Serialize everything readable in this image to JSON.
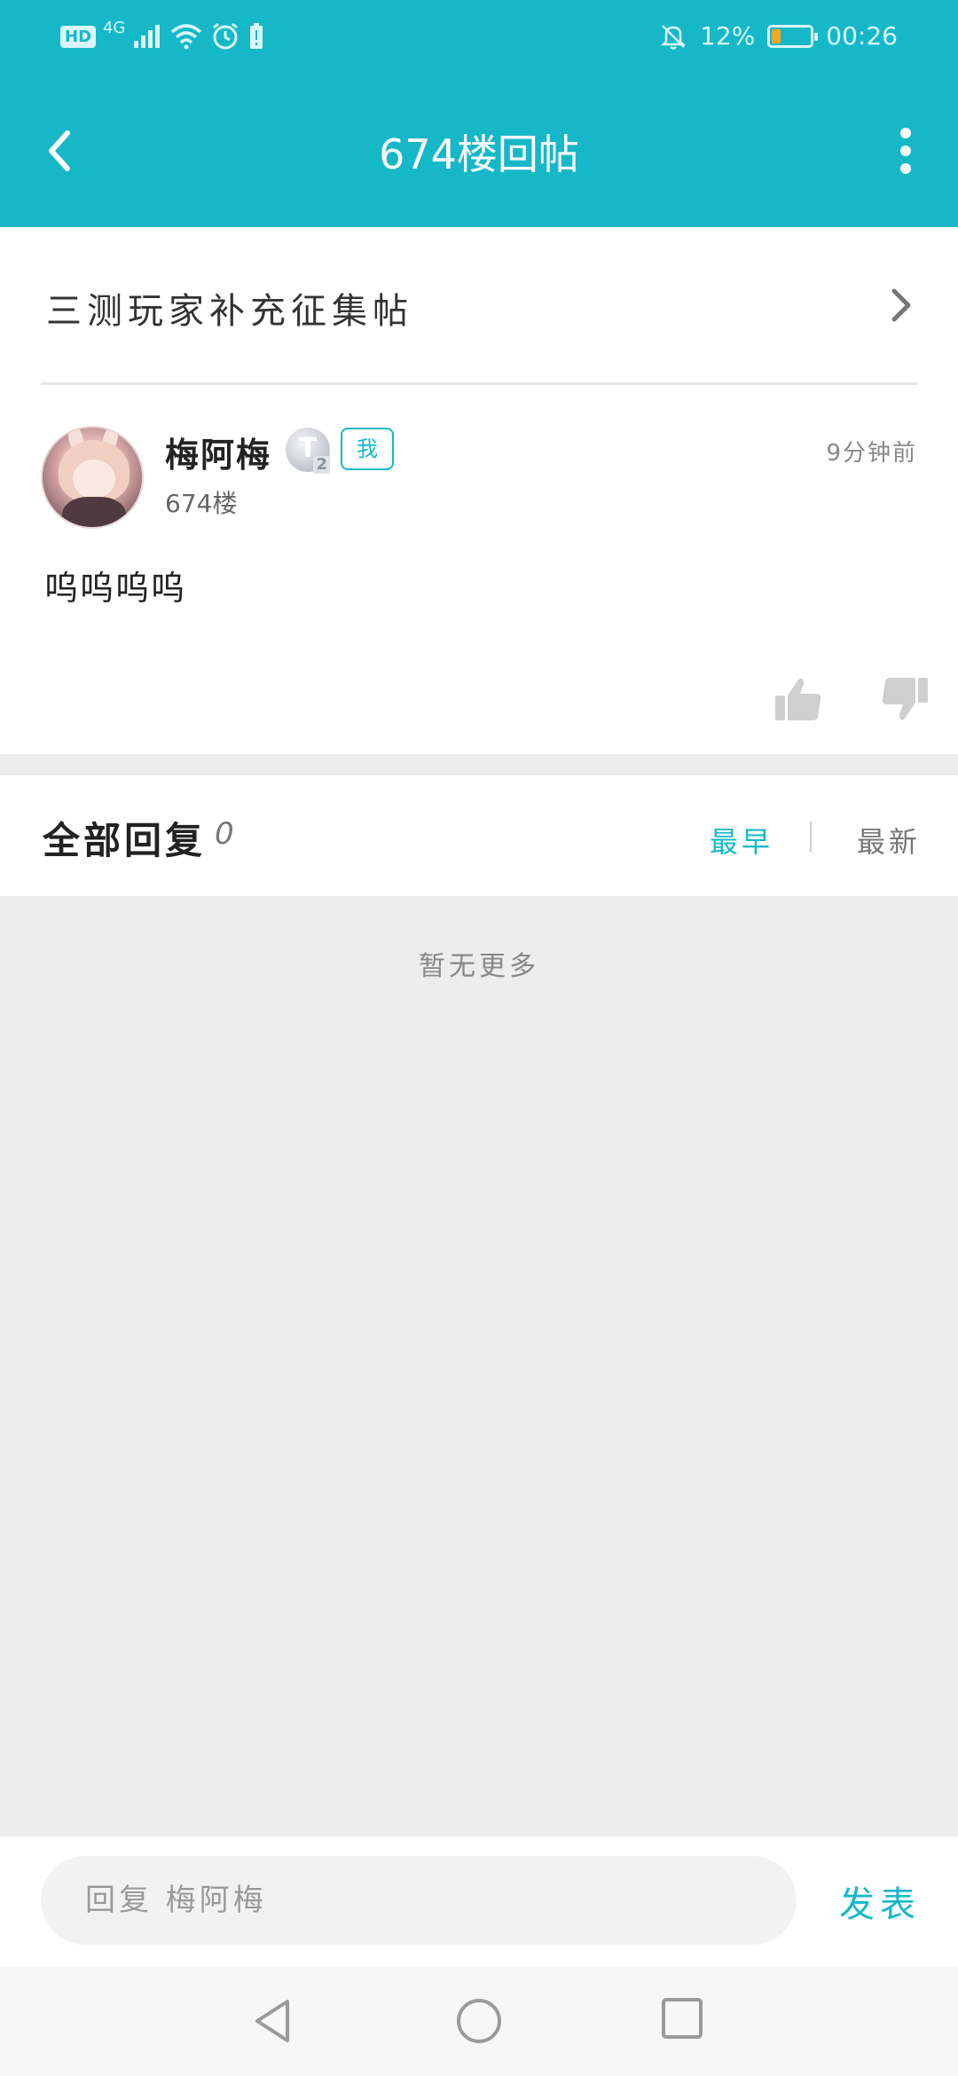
{
  "status_bar": {
    "network_badge": "HD",
    "network_type": "4G",
    "battery_percent": "12%",
    "time": "00:26",
    "battery_color": "#f5a623"
  },
  "header": {
    "title": "674楼回帖",
    "back_icon": "back-arrow-icon",
    "more_icon": "more-vertical-icon",
    "background": "#16b8c8"
  },
  "thread_link": {
    "title": "三测玩家补充征集帖"
  },
  "post": {
    "username": "梅阿梅",
    "level_badge": "T",
    "level_sub": "2",
    "me_tag": "我",
    "floor": "674楼",
    "time": "9分钟前",
    "body": "呜呜呜呜"
  },
  "replies": {
    "title": "全部回复",
    "count": "0",
    "sort_earliest": "最早",
    "sort_latest": "最新",
    "empty_text": "暂无更多"
  },
  "reply_bar": {
    "placeholder": "回复 梅阿梅",
    "send_label": "发表"
  },
  "colors": {
    "accent": "#16b8c8"
  }
}
